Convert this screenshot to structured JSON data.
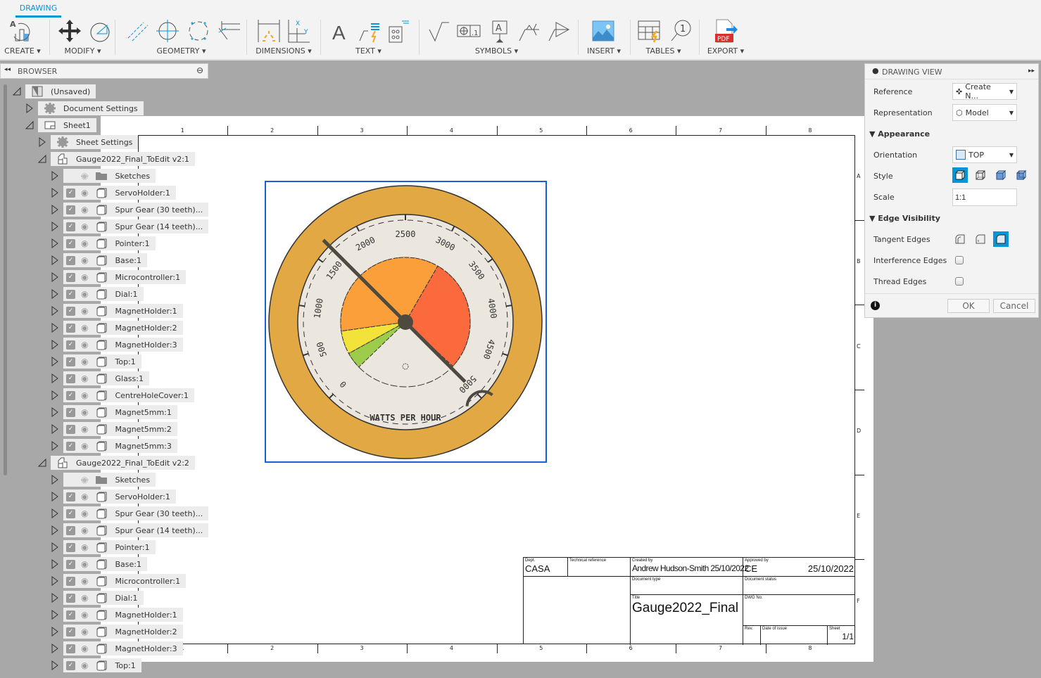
{
  "toolbar": {
    "tab": "DRAWING",
    "groups": [
      {
        "label": "CREATE ▾"
      },
      {
        "label": "MODIFY ▾"
      },
      {
        "label": "GEOMETRY ▾"
      },
      {
        "label": "DIMENSIONS ▾"
      },
      {
        "label": "TEXT ▾"
      },
      {
        "label": "SYMBOLS ▾"
      },
      {
        "label": "INSERT ▾"
      },
      {
        "label": "TABLES ▾"
      },
      {
        "label": "EXPORT ▾"
      }
    ],
    "accent": "#0696d7"
  },
  "browser": {
    "title": "BROWSER",
    "items": [
      {
        "level": 0,
        "type": "document",
        "label": "(Unsaved)",
        "expanded": true
      },
      {
        "level": 1,
        "type": "gear",
        "label": "Document Settings",
        "expanded": false
      },
      {
        "level": 1,
        "type": "sheet",
        "label": "Sheet1",
        "expanded": true
      },
      {
        "level": 2,
        "type": "gear",
        "label": "Sheet Settings",
        "expanded": false
      },
      {
        "level": 2,
        "type": "component",
        "label": "Gauge2022_Final_ToEdit v2:1",
        "expanded": true
      },
      {
        "level": 3,
        "type": "folder",
        "label": "Sketches",
        "visible": false
      },
      {
        "level": 3,
        "type": "body",
        "label": "ServoHolder:1",
        "visible": true
      },
      {
        "level": 3,
        "type": "body",
        "label": "Spur Gear (30 teeth)...",
        "visible": true
      },
      {
        "level": 3,
        "type": "body",
        "label": "Spur Gear (14 teeth)...",
        "visible": true
      },
      {
        "level": 3,
        "type": "body",
        "label": "Pointer:1",
        "visible": true
      },
      {
        "level": 3,
        "type": "body",
        "label": "Base:1",
        "visible": true
      },
      {
        "level": 3,
        "type": "body",
        "label": "Microcontroller:1",
        "visible": true
      },
      {
        "level": 3,
        "type": "body",
        "label": "Dial:1",
        "visible": true
      },
      {
        "level": 3,
        "type": "body",
        "label": "MagnetHolder:1",
        "visible": true
      },
      {
        "level": 3,
        "type": "body",
        "label": "MagnetHolder:2",
        "visible": true
      },
      {
        "level": 3,
        "type": "body",
        "label": "MagnetHolder:3",
        "visible": true
      },
      {
        "level": 3,
        "type": "body",
        "label": "Top:1",
        "visible": true
      },
      {
        "level": 3,
        "type": "body",
        "label": "Glass:1",
        "visible": true
      },
      {
        "level": 3,
        "type": "body",
        "label": "CentreHoleCover:1",
        "visible": true
      },
      {
        "level": 3,
        "type": "body",
        "label": "Magnet5mm:1",
        "visible": true
      },
      {
        "level": 3,
        "type": "body",
        "label": "Magnet5mm:2",
        "visible": true
      },
      {
        "level": 3,
        "type": "body",
        "label": "Magnet5mm:3",
        "visible": true
      },
      {
        "level": 2,
        "type": "component",
        "label": "Gauge2022_Final_ToEdit v2:2",
        "expanded": true
      },
      {
        "level": 3,
        "type": "folder",
        "label": "Sketches",
        "visible": false
      },
      {
        "level": 3,
        "type": "body",
        "label": "ServoHolder:1",
        "visible": true
      },
      {
        "level": 3,
        "type": "body",
        "label": "Spur Gear (30 teeth)...",
        "visible": true
      },
      {
        "level": 3,
        "type": "body",
        "label": "Spur Gear (14 teeth)...",
        "visible": true
      },
      {
        "level": 3,
        "type": "body",
        "label": "Pointer:1",
        "visible": true
      },
      {
        "level": 3,
        "type": "body",
        "label": "Base:1",
        "visible": true
      },
      {
        "level": 3,
        "type": "body",
        "label": "Microcontroller:1",
        "visible": true
      },
      {
        "level": 3,
        "type": "body",
        "label": "Dial:1",
        "visible": true
      },
      {
        "level": 3,
        "type": "body",
        "label": "MagnetHolder:1",
        "visible": true
      },
      {
        "level": 3,
        "type": "body",
        "label": "MagnetHolder:2",
        "visible": true
      },
      {
        "level": 3,
        "type": "body",
        "label": "MagnetHolder:3",
        "visible": true
      },
      {
        "level": 3,
        "type": "body",
        "label": "Top:1",
        "visible": true
      }
    ]
  },
  "sheet": {
    "zone_columns": [
      "1",
      "2",
      "3",
      "4",
      "5",
      "6",
      "7",
      "8"
    ],
    "zone_rows": [
      "A",
      "B",
      "C",
      "D",
      "E",
      "F"
    ],
    "gauge": {
      "dial_labels": [
        "0",
        "500",
        "1000",
        "1500",
        "2000",
        "2500",
        "3000",
        "3500",
        "4000",
        "4500",
        "5000"
      ],
      "unit_text": "WATTS PER HOUR",
      "colors": {
        "rim": "#e2a843",
        "face": "#ebe7de",
        "orange": "#fb9f3b",
        "red": "#fb6a3c",
        "yellow": "#f2e23a",
        "green": "#9ccc4a",
        "needle": "#4e4a40"
      }
    },
    "title_block": {
      "dept_caption": "Dept.",
      "dept": "CASA",
      "techref_caption": "Technical reference",
      "created_caption": "Created by",
      "created_by": "Andrew Hudson-Smith",
      "created_date": "25/10/2022",
      "approved_caption": "Approved by",
      "approved_by": "CE",
      "approved_date": "25/10/2022",
      "doctype_caption": "Document type",
      "docstatus_caption": "Document status",
      "title_caption": "Title",
      "title": "Gauge2022_Final",
      "dwgno_caption": "DWG No.",
      "rev_caption": "Rev.",
      "issue_caption": "Date of issue",
      "sheet_caption": "Sheet",
      "sheet": "1/1"
    }
  },
  "panel": {
    "title": "DRAWING VIEW",
    "reference_label": "Reference",
    "reference_value": "Create N...",
    "representation_label": "Representation",
    "representation_value": "Model",
    "appearance_section": "Appearance",
    "orientation_label": "Orientation",
    "orientation_value": "TOP",
    "style_label": "Style",
    "style_selected": "visible-edges",
    "scale_label": "Scale",
    "scale_value": "1:1",
    "edge_section": "Edge Visibility",
    "tangent_label": "Tangent Edges",
    "tangent_selected": "off",
    "interference_label": "Interference Edges",
    "interference_checked": false,
    "thread_label": "Thread Edges",
    "thread_checked": false,
    "ok": "OK",
    "cancel": "Cancel"
  }
}
